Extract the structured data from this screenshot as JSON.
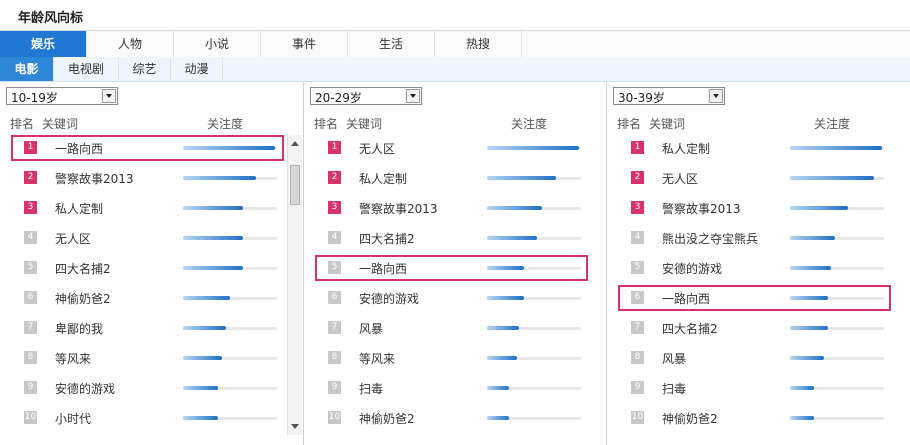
{
  "header": {
    "title": "年龄风向标"
  },
  "category_tabs": [
    {
      "label": "娱乐",
      "active": true
    },
    {
      "label": "人物",
      "active": false
    },
    {
      "label": "小说",
      "active": false
    },
    {
      "label": "事件",
      "active": false
    },
    {
      "label": "生活",
      "active": false
    },
    {
      "label": "热搜",
      "active": false
    }
  ],
  "sub_tabs": [
    {
      "label": "电影",
      "active": true
    },
    {
      "label": "电视剧",
      "active": false
    },
    {
      "label": "综艺",
      "active": false
    },
    {
      "label": "动漫",
      "active": false
    }
  ],
  "columns": {
    "rank": "排名",
    "keyword": "关键词",
    "attention": "关注度"
  },
  "colors": {
    "accent": "#1f78d4",
    "highlight": "#d6336c",
    "top_badge": "#d6336c",
    "badge": "#c8c8c8"
  },
  "panels": [
    {
      "age_select": "10-19岁",
      "highlight_rank": 1,
      "rows": [
        {
          "rank": "1",
          "keyword": "一路向西",
          "attention": 0.98
        },
        {
          "rank": "2",
          "keyword": "警察故事2013",
          "attention": 0.78
        },
        {
          "rank": "3",
          "keyword": "私人定制",
          "attention": 0.64
        },
        {
          "rank": "4",
          "keyword": "无人区",
          "attention": 0.64
        },
        {
          "rank": "5",
          "keyword": "四大名捕2",
          "attention": 0.64
        },
        {
          "rank": "6",
          "keyword": "神偷奶爸2",
          "attention": 0.5
        },
        {
          "rank": "7",
          "keyword": "卑鄙的我",
          "attention": 0.46
        },
        {
          "rank": "8",
          "keyword": "等风来",
          "attention": 0.41
        },
        {
          "rank": "9",
          "keyword": "安德的游戏",
          "attention": 0.37
        },
        {
          "rank": "10",
          "keyword": "小时代",
          "attention": 0.37
        }
      ]
    },
    {
      "age_select": "20-29岁",
      "highlight_rank": 5,
      "rows": [
        {
          "rank": "1",
          "keyword": "无人区",
          "attention": 0.98
        },
        {
          "rank": "2",
          "keyword": "私人定制",
          "attention": 0.73
        },
        {
          "rank": "3",
          "keyword": "警察故事2013",
          "attention": 0.59
        },
        {
          "rank": "4",
          "keyword": "四大名捕2",
          "attention": 0.53
        },
        {
          "rank": "5",
          "keyword": "一路向西",
          "attention": 0.39
        },
        {
          "rank": "6",
          "keyword": "安德的游戏",
          "attention": 0.39
        },
        {
          "rank": "7",
          "keyword": "风暴",
          "attention": 0.34
        },
        {
          "rank": "8",
          "keyword": "等风来",
          "attention": 0.32
        },
        {
          "rank": "9",
          "keyword": "扫毒",
          "attention": 0.23
        },
        {
          "rank": "10",
          "keyword": "神偷奶爸2",
          "attention": 0.23
        }
      ]
    },
    {
      "age_select": "30-39岁",
      "highlight_rank": 6,
      "rows": [
        {
          "rank": "1",
          "keyword": "私人定制",
          "attention": 0.98
        },
        {
          "rank": "2",
          "keyword": "无人区",
          "attention": 0.89
        },
        {
          "rank": "3",
          "keyword": "警察故事2013",
          "attention": 0.62
        },
        {
          "rank": "4",
          "keyword": "熊出没之夺宝熊兵",
          "attention": 0.48
        },
        {
          "rank": "5",
          "keyword": "安德的游戏",
          "attention": 0.44
        },
        {
          "rank": "6",
          "keyword": "一路向西",
          "attention": 0.4
        },
        {
          "rank": "7",
          "keyword": "四大名捕2",
          "attention": 0.4
        },
        {
          "rank": "8",
          "keyword": "风暴",
          "attention": 0.36
        },
        {
          "rank": "9",
          "keyword": "扫毒",
          "attention": 0.25
        },
        {
          "rank": "10",
          "keyword": "神偷奶爸2",
          "attention": 0.25
        }
      ]
    }
  ]
}
